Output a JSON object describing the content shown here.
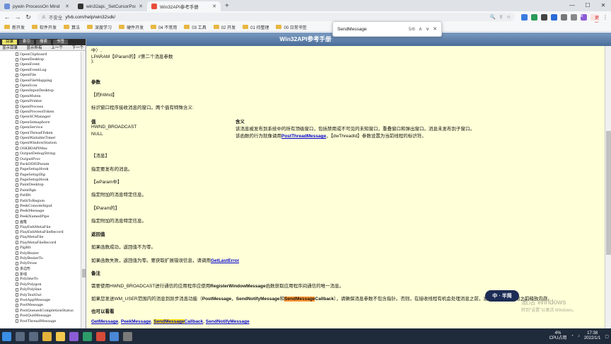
{
  "browser": {
    "tabs": [
      {
        "label": "pywin ProcessOn Mind",
        "active": false
      },
      {
        "label": "win32api._SetCursorPos_meth",
        "active": false
      },
      {
        "label": "Win32API参考手册",
        "active": true
      }
    ],
    "new_tab": "+",
    "address": {
      "warning": "不安全",
      "url": "yfvb.com/help/win32sdk/"
    },
    "update_button": "更新",
    "avatar_letter": "e"
  },
  "bookmarks": [
    "新开发",
    "软件开发",
    "算法",
    "深度学习",
    "硬件开发",
    "04 不常用",
    "03 工具",
    "02 开发",
    "01 待整理",
    "00 日常书签"
  ],
  "findbar": {
    "query": "SendMessage",
    "count": "5/6",
    "prev": "∧",
    "next": "∨",
    "close": "✕"
  },
  "page": {
    "header_title": "Win32API参考手册",
    "left_tabs": [
      "目录",
      "索引",
      "搜索",
      "书签"
    ],
    "left_nav": {
      "show_toc": "显示目录",
      "up": "上一个",
      "down": "下一个",
      "top": "显示所有"
    },
    "left_items": [
      "OpenClipboard",
      "OpenDesktop",
      "OpenEvent",
      "OpenEventLog",
      "OpenFile",
      "OpenFileMapping",
      "OpenIcon",
      "OpenInputDesktop",
      "OpenMutex",
      "OpenPrinter",
      "OpenProcess",
      "OpenProcessToken",
      "OpenSCManager",
      "OpenSemaphore",
      "OpenService",
      "OpenThreadToken",
      "OpenWaitableTimer",
      "OpenWindowStation",
      "OSKBDAPIMns",
      "OutputDebugString",
      "OutputProc",
      "PackDDElParam",
      "PageSetupHook",
      "PageSetupDlg",
      "PageSetupHook",
      "PaintDesktop",
      "PaintRgn",
      "PatBlt",
      "PathToRegion",
      "PeekConsoleInput",
      "PeekMessage",
      "PeekNamedPipe",
      "画笔",
      "PlayEnhMetaFile",
      "PlayEnhMetaFileRecord",
      "PlayMetaFile",
      "PlayMetaFileRecord",
      "PlgBlt",
      "PolyBezier",
      "PolyBezierTo",
      "PolyDraw",
      "多边形",
      "折线",
      "PolylineTo",
      "PolyPolygon",
      "PolyPolyline",
      "PolyTextOut",
      "PostAppMessage",
      "PostMessage",
      "PostQueuedCompletionStatus",
      "PostQuitMessage",
      "PostThreadMessage"
    ],
    "content": {
      "top_line": "中）,",
      "lparam_decl": "LPARAM【lParam的】//第二个消息参数",
      "close_brace": ");",
      "params_heading": "参数",
      "hwnd_label": "【的hWnd】",
      "hwnd_desc": "标识窗口程序接收消息的窗口。两个值有特殊含义:",
      "table_value_header": "值",
      "table_meaning_header": "含义",
      "broadcast_value": "HWND_BROADCAST",
      "null_value": "NULL",
      "broadcast_meaning": "该消息被发布到系统中的所有顶级窗口，包括禁用或不可见的未知窗口，重叠窗口和弹出窗口。消息未发布到子窗口。",
      "null_meaning_pre": "该函数的行为就像调用",
      "null_meaning_link": "PostThreadMessage",
      "null_meaning_post": "，【dwThreadId】参数设置为当前线程的标识符。",
      "msg_label": "【消息】",
      "msg_desc": "指定要发布的消息。",
      "wparam_label": "【wParam中】",
      "wparam_desc": "指定附加的消息特定信息。",
      "lparam_label": "【lParam的】",
      "lparam_desc": "指定附加的消息特定信息。",
      "return_heading": "返回值",
      "return_success": "如果函数成功，返回值不为零。",
      "return_fail_pre": "如果函数失败，返回值为零。要获取扩展错误信息，请调用",
      "return_fail_link": "GetLastError",
      "remarks_heading": "备注",
      "remark1_pre": "需要使用HWND_BROADCAST进行通信的应用程序应使用",
      "remark1_bold": "RegisterWindowMessage",
      "remark1_post": "函数获取应用程序间通信的唯一消息。",
      "remark2_pre": "如果您发送WM_USER范围内的消息到异步消息功能（",
      "remark2_b1": "PostMessage",
      "remark2_sep1": "，",
      "remark2_b2": "SendNotifyMessage",
      "remark2_and": "和",
      "remark2_hl": "SendMessage",
      "remark2_b3": "Callback",
      "remark2_post": "），请确保消息参数不包含指针。否则，在接收线程有机会处理消息之前，发送线程将在使用之前释放内存。",
      "see_also_heading": "也可以看看",
      "see_also_1": "GetMessage",
      "see_also_2": "PeekMessage",
      "see_also_3_hl": "SendMessage",
      "see_also_3_post": "Callback",
      "see_also_4": "SendNotifyMessage"
    }
  },
  "watermark": {
    "line1": "激活 Windows",
    "line2": "转到\"设置\"以激活 Windows。"
  },
  "float_badge": "中ㆍ半简",
  "taskbar": {
    "tray_temp": "4%",
    "tray_label": "CPU占用",
    "time": "17:38",
    "date": "2022/1/1"
  }
}
